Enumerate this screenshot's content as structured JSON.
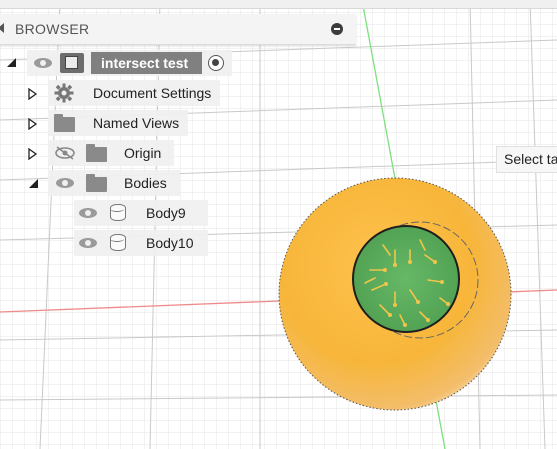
{
  "browser": {
    "title": "BROWSER",
    "root": {
      "label": "intersect test"
    },
    "items": [
      {
        "label": "Document Settings"
      },
      {
        "label": "Named Views"
      },
      {
        "label": "Origin"
      },
      {
        "label": "Bodies"
      },
      {
        "label": "Body9"
      },
      {
        "label": "Body10"
      }
    ]
  },
  "viewport": {
    "tooltip": "Select ta",
    "colors": {
      "sphere": "#f7b63a",
      "intersection": "#5fae5a",
      "axis_x": "#f08080",
      "axis_y": "#66dd66",
      "grid": "#d3d3d3"
    }
  }
}
